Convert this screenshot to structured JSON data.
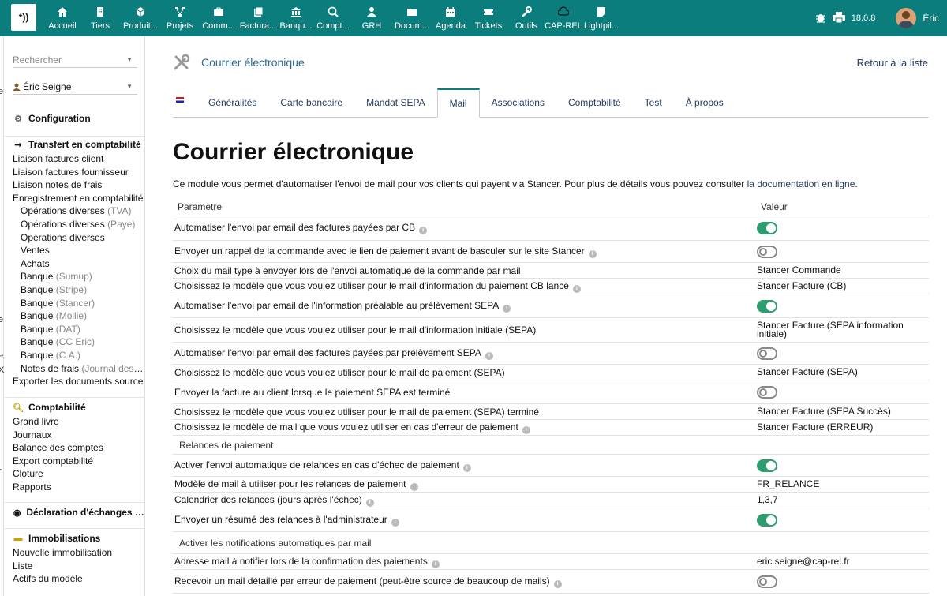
{
  "topbar": {
    "logo_text": "*))",
    "menu": [
      {
        "label": "Accueil",
        "icon": "home-icon"
      },
      {
        "label": "Tiers",
        "icon": "building-icon"
      },
      {
        "label": "Produit...",
        "icon": "cube-icon"
      },
      {
        "label": "Projets",
        "icon": "sitemap-icon"
      },
      {
        "label": "Comm...",
        "icon": "briefcase-icon"
      },
      {
        "label": "Factura...",
        "icon": "invoice-icon"
      },
      {
        "label": "Banqu...",
        "icon": "bank-icon"
      },
      {
        "label": "Compt...",
        "icon": "magnifier-dollar-icon"
      },
      {
        "label": "GRH",
        "icon": "user-tie-icon"
      },
      {
        "label": "Docum...",
        "icon": "folder-icon"
      },
      {
        "label": "Agenda",
        "icon": "calendar-icon"
      },
      {
        "label": "Tickets",
        "icon": "ticket-icon"
      },
      {
        "label": "Outils",
        "icon": "wrench-icon"
      },
      {
        "label": "CAP-REL",
        "icon": "cloud-icon"
      },
      {
        "label": "Lightpil...",
        "icon": "note-icon"
      }
    ],
    "version": "18.0.8",
    "username": "Éric"
  },
  "left_edge_chars": [
    "e",
    "e",
    "e",
    "X",
    "i",
    "r"
  ],
  "sidebar": {
    "search_placeholder": "Rechercher",
    "user": "Éric Seigne",
    "configuration": "Configuration",
    "transfert": {
      "title": "Transfert en comptabilité",
      "items": [
        {
          "label": "Liaison factures client",
          "muted": "",
          "sub": false
        },
        {
          "label": "Liaison factures fournisseur",
          "muted": "",
          "sub": false
        },
        {
          "label": "Liaison notes de frais",
          "muted": "",
          "sub": false
        },
        {
          "label": "Enregistrement en comptabilité",
          "muted": "",
          "sub": false
        },
        {
          "label": "Opérations diverses",
          "muted": "(TVA)",
          "sub": true
        },
        {
          "label": "Opérations diverses",
          "muted": "(Paye)",
          "sub": true
        },
        {
          "label": "Opérations diverses",
          "muted": "",
          "sub": true
        },
        {
          "label": "Ventes",
          "muted": "",
          "sub": true
        },
        {
          "label": "Achats",
          "muted": "",
          "sub": true
        },
        {
          "label": "Banque",
          "muted": "(Sumup)",
          "sub": true
        },
        {
          "label": "Banque",
          "muted": "(Stripe)",
          "sub": true
        },
        {
          "label": "Banque",
          "muted": "(Stancer)",
          "sub": true
        },
        {
          "label": "Banque",
          "muted": "(Mollie)",
          "sub": true
        },
        {
          "label": "Banque",
          "muted": "(DAT)",
          "sub": true
        },
        {
          "label": "Banque",
          "muted": "(CC Eric)",
          "sub": true
        },
        {
          "label": "Banque",
          "muted": "(C.A.)",
          "sub": true
        },
        {
          "label": "Notes de frais",
          "muted": "(Journal des notes de frais)",
          "sub": true
        },
        {
          "label": "Exporter les documents source",
          "muted": "",
          "sub": false
        }
      ]
    },
    "comptabilite": {
      "title": "Comptabilité",
      "items": [
        "Grand livre",
        "Journaux",
        "Balance des comptes",
        "Export comptabilité",
        "Cloture",
        "Rapports"
      ]
    },
    "declaration": "Déclaration d'échanges de biens",
    "immobilisations": {
      "title": "Immobilisations",
      "items": [
        "Nouvelle immobilisation",
        "Liste",
        "Actifs du modèle"
      ]
    }
  },
  "main": {
    "head_title": "Courrier électronique",
    "back_link": "Retour à la liste",
    "tabs": [
      "Généralités",
      "Carte bancaire",
      "Mandat SEPA",
      "Mail",
      "Associations",
      "Comptabilité",
      "Test",
      "À propos"
    ],
    "active_tab": "Mail",
    "title": "Courrier électronique",
    "intro_text": "Ce module vous permet d'automatiser l'envoi de mail pour vos clients qui payent via Stancer. Pour plus de détails vous pouvez consulter ",
    "intro_link": "la documentation en ligne",
    "intro_end": ".",
    "table": {
      "col_param": "Paramètre",
      "col_value": "Valeur",
      "rows": [
        {
          "type": "row",
          "label": "Automatiser l'envoi par email des factures payées par CB",
          "info": true,
          "kind": "toggle",
          "on": true
        },
        {
          "type": "row",
          "label": "Envoyer un rappel de la commande avec le lien de paiement avant de basculer sur le site Stancer",
          "info": true,
          "kind": "toggle",
          "on": false
        },
        {
          "type": "row",
          "label": "Choix du mail type à envoyer lors de l'envoi automatique de la commande par mail",
          "info": false,
          "kind": "text",
          "value": "Stancer Commande"
        },
        {
          "type": "row",
          "label": "Choisissez le modèle que vous voulez utiliser pour le mail d'information du paiement CB lancé",
          "info": true,
          "kind": "text",
          "value": "Stancer Facture (CB)"
        },
        {
          "type": "row",
          "label": "Automatiser l'envoi par email de l'information préalable au prélèvement SEPA",
          "info": true,
          "kind": "toggle",
          "on": true
        },
        {
          "type": "row",
          "label": "Choisissez le modèle que vous voulez utiliser pour le mail d'information initiale (SEPA)",
          "info": false,
          "kind": "text",
          "value": "Stancer Facture (SEPA information initiale)"
        },
        {
          "type": "row",
          "label": "Automatiser l'envoi par email des factures payées par prélèvement SEPA",
          "info": true,
          "kind": "toggle",
          "on": false
        },
        {
          "type": "row",
          "label": "Choisissez le modèle que vous voulez utiliser pour le mail de paiement (SEPA)",
          "info": false,
          "kind": "text",
          "value": "Stancer Facture (SEPA)"
        },
        {
          "type": "row",
          "label": "Envoyer la facture au client lorsque le paiement SEPA est terminé",
          "info": false,
          "kind": "toggle",
          "on": false
        },
        {
          "type": "row",
          "label": "Choisissez le modèle que vous voulez utiliser pour le mail de paiement (SEPA) terminé",
          "info": false,
          "kind": "text",
          "value": "Stancer Facture (SEPA Succès)"
        },
        {
          "type": "row",
          "label": "Choisissez le modèle de mail que vous voulez utiliser en cas d'erreur de paiement",
          "info": true,
          "kind": "text",
          "value": "Stancer Facture (ERREUR)"
        },
        {
          "type": "sub",
          "label": "Relances de paiement"
        },
        {
          "type": "row",
          "label": "Activer l'envoi automatique de relances en cas d'échec de paiement",
          "info": true,
          "kind": "toggle",
          "on": true
        },
        {
          "type": "row",
          "label": "Modèle de mail à utiliser pour les relances de paiement",
          "info": true,
          "kind": "text",
          "value": "FR_RELANCE"
        },
        {
          "type": "row",
          "label": "Calendrier des relances (jours après l'échec)",
          "info": true,
          "kind": "text",
          "value": "1,3,7"
        },
        {
          "type": "row",
          "label": "Envoyer un résumé des relances à l'administrateur",
          "info": true,
          "kind": "toggle",
          "on": true
        },
        {
          "type": "sub",
          "label": "Activer les notifications automatiques par mail"
        },
        {
          "type": "row",
          "label": "Adresse mail à notifier lors de la confirmation des paiements",
          "info": true,
          "kind": "text",
          "value": "eric.seigne@cap-rel.fr"
        },
        {
          "type": "row",
          "label": "Recevoir un mail détaillé par erreur de paiement (peut-être source de beaucoup de mails)",
          "info": true,
          "kind": "toggle",
          "on": false
        }
      ]
    }
  },
  "colors": {
    "topbar": "#0b7d7d",
    "toggle_on": "#2d9c6e",
    "link": "#263c5c"
  }
}
